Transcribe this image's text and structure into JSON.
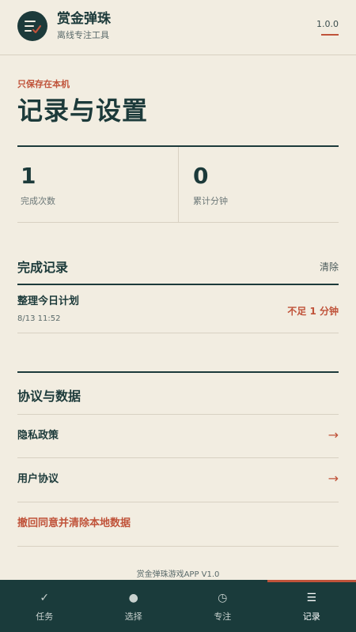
{
  "app": {
    "name": "赏金弹珠",
    "subtitle": "离线专注工具",
    "version": "1.0.0"
  },
  "page": {
    "kicker": "只保存在本机",
    "title": "记录与设置"
  },
  "stats": [
    {
      "value": "1",
      "label": "完成次数"
    },
    {
      "value": "0",
      "label": "累计分钟"
    }
  ],
  "records_section": {
    "title": "完成记录",
    "clear_label": "清除",
    "items": [
      {
        "title": "整理今日计划",
        "time": "8/13 11:52",
        "status": "不足 1 分钟"
      }
    ]
  },
  "data_section": {
    "title": "协议与数据",
    "items": [
      {
        "label": "隐私政策",
        "arrow": "→"
      },
      {
        "label": "用户协议",
        "arrow": "→"
      },
      {
        "label": "撤回同意并清除本地数据"
      }
    ]
  },
  "footer": "赏金弹珠游戏APP V1.0",
  "tabs": [
    {
      "icon": "check-icon",
      "glyph": "✓",
      "label": "任务"
    },
    {
      "icon": "dot-icon",
      "glyph": "●",
      "label": "选择"
    },
    {
      "icon": "clock-icon",
      "glyph": "◷",
      "label": "专注"
    },
    {
      "icon": "list-icon",
      "glyph": "☰",
      "label": "记录",
      "active": true
    }
  ],
  "colors": {
    "background": "#f2ede1",
    "primary": "#1c3a3a",
    "accent": "#c0533a",
    "tabbar": "#1a3b3b"
  }
}
